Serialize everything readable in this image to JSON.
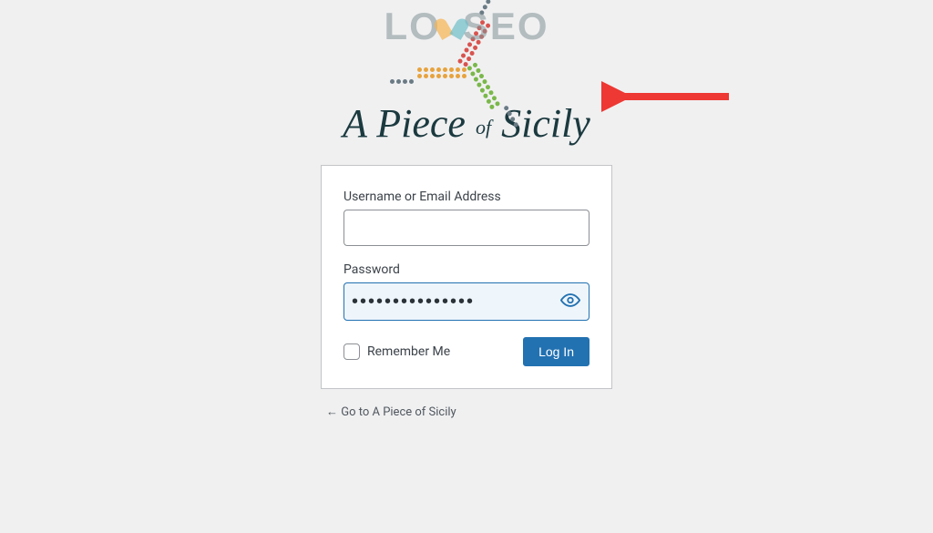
{
  "watermark": {
    "left": "LO",
    "right": "SEO"
  },
  "brand": {
    "text_prefix": "A ",
    "text_main1": "Piece ",
    "text_of": "of",
    "text_main2": " Sicily"
  },
  "form": {
    "username_label": "Username or Email Address",
    "username_value": "",
    "password_label": "Password",
    "password_value": "•••••••••••••••",
    "remember_label": "Remember Me",
    "submit_label": "Log In"
  },
  "nav": {
    "back_link": "← Go to A Piece of Sicily"
  },
  "colors": {
    "accent": "#2271b1",
    "arrow": "#ed3833"
  }
}
